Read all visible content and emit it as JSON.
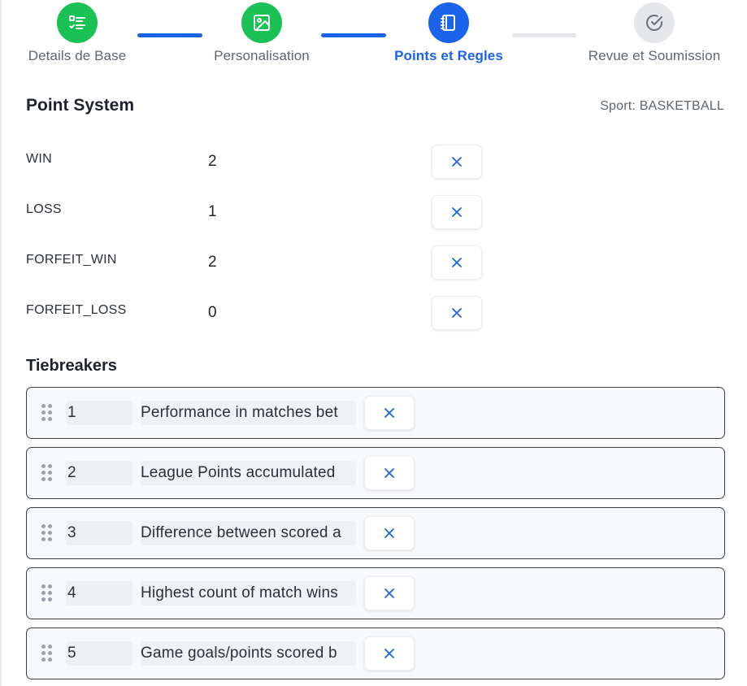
{
  "stepper": {
    "steps": [
      {
        "label": "Details de Base",
        "icon": "checklist-icon",
        "state": "complete"
      },
      {
        "label": "Personalisation",
        "icon": "image-icon",
        "state": "complete"
      },
      {
        "label": "Points et Regles",
        "icon": "notebook-icon",
        "state": "active"
      },
      {
        "label": "Revue et Soumission",
        "icon": "check-circle-icon",
        "state": "pending"
      }
    ]
  },
  "point_system": {
    "title": "Point System",
    "sport": "Sport: BASKETBALL",
    "rows": [
      {
        "name": "WIN",
        "value": "2"
      },
      {
        "name": "LOSS",
        "value": "1"
      },
      {
        "name": "FORFEIT_WIN",
        "value": "2"
      },
      {
        "name": "FORFEIT_LOSS",
        "value": "0"
      }
    ],
    "remove_icon": "x-icon"
  },
  "tiebreakers": {
    "title": "Tiebreakers",
    "items": [
      {
        "rank": "1",
        "text": "Performance in matches bet"
      },
      {
        "rank": "2",
        "text": "League Points accumulated"
      },
      {
        "rank": "3",
        "text": "Difference between scored a"
      },
      {
        "rank": "4",
        "text": "Highest count of match wins"
      },
      {
        "rank": "5",
        "text": "Game goals/points scored b"
      }
    ]
  },
  "colors": {
    "complete": "#1ac155",
    "active": "#1b63e8",
    "pending": "#e5e7eb",
    "remove_x": "#1b63e8"
  }
}
